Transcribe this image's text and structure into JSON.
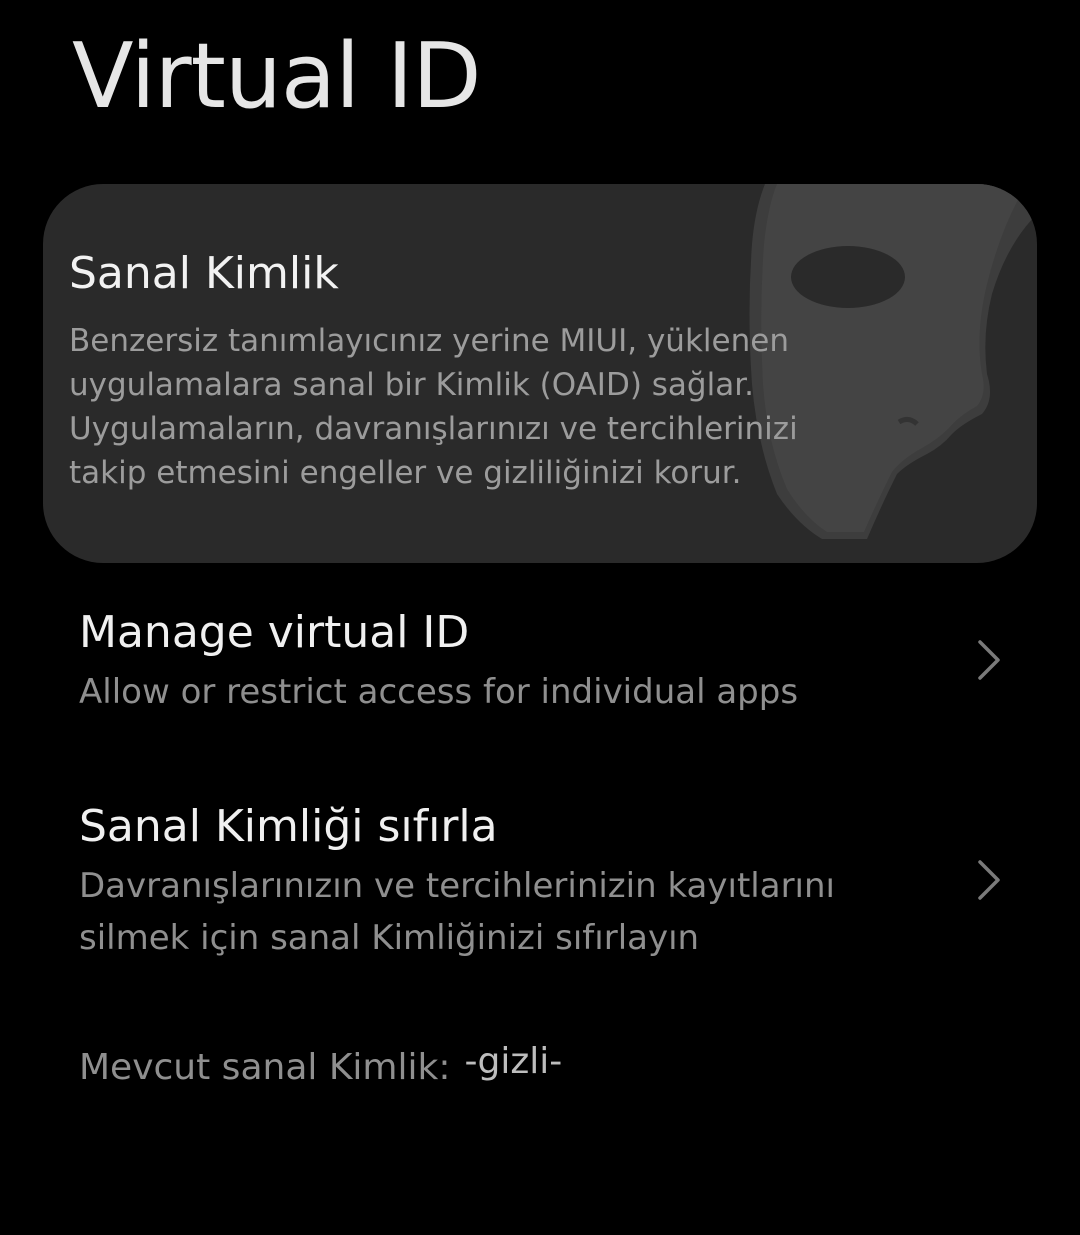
{
  "header": {
    "title": "Virtual ID"
  },
  "info_card": {
    "title": "Sanal Kimlik",
    "description_lines": [
      "Benzersiz tanımlayıcınız yerine MIUI, yüklenen",
      "uygulamalara sanal bir Kimlik (OAID) sağlar.",
      "Uygulamaların, davranışlarınızı ve tercihlerinizi",
      "takip etmesini engeller ve gizliliğinizi korur."
    ],
    "illustration_icon": "theater-mask-icon"
  },
  "settings": {
    "manage": {
      "title": "Manage virtual ID",
      "subtitle": "Allow or restrict access for individual apps",
      "icon": "chevron-right-icon"
    },
    "reset": {
      "title": "Sanal Kimliği sıfırla",
      "subtitle_lines": [
        "Davranışlarınızın ve tercihlerinizin kayıtlarını",
        "silmek için sanal Kimliğinizi sıfırlayın"
      ],
      "icon": "chevron-right-icon"
    }
  },
  "current_id": {
    "label": "Mevcut sanal Kimlik:",
    "value": "-gizli-"
  },
  "colors": {
    "background": "#000000",
    "card_background": "#2a2a2a",
    "primary_text": "#f0f0f0",
    "secondary_text": "#8f8f8f"
  }
}
